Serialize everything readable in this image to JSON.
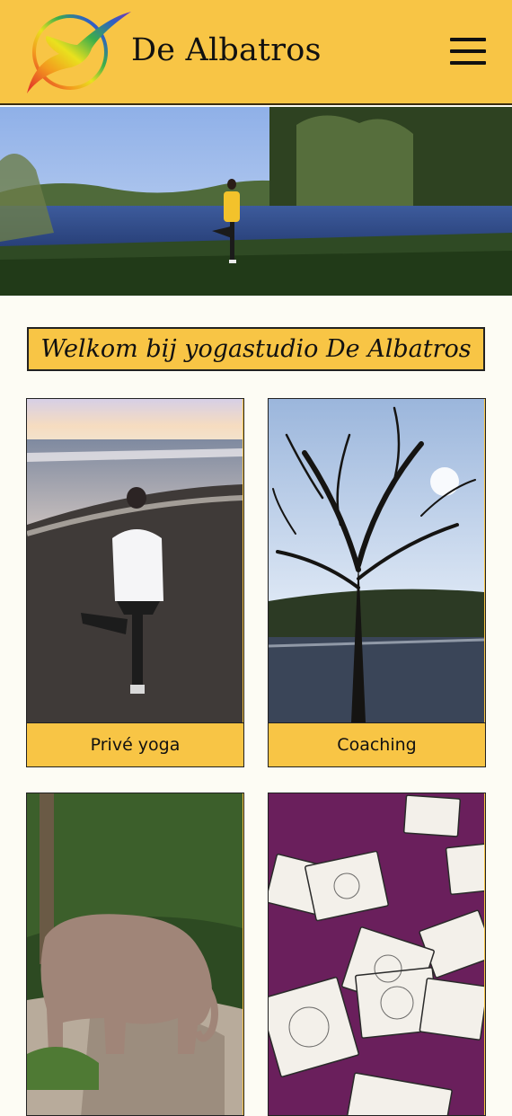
{
  "header": {
    "brand": "De Albatros",
    "menu_icon": "hamburger-menu-icon"
  },
  "main": {
    "welcome_title": "Welkom bij yogastudio De Albatros"
  },
  "cards": [
    {
      "label": "Privé yoga"
    },
    {
      "label": "Coaching"
    },
    {
      "label": ""
    },
    {
      "label": ""
    }
  ],
  "colors": {
    "brand_yellow": "#f8c545",
    "page_bg": "#fdfcf4",
    "border": "#222222"
  }
}
